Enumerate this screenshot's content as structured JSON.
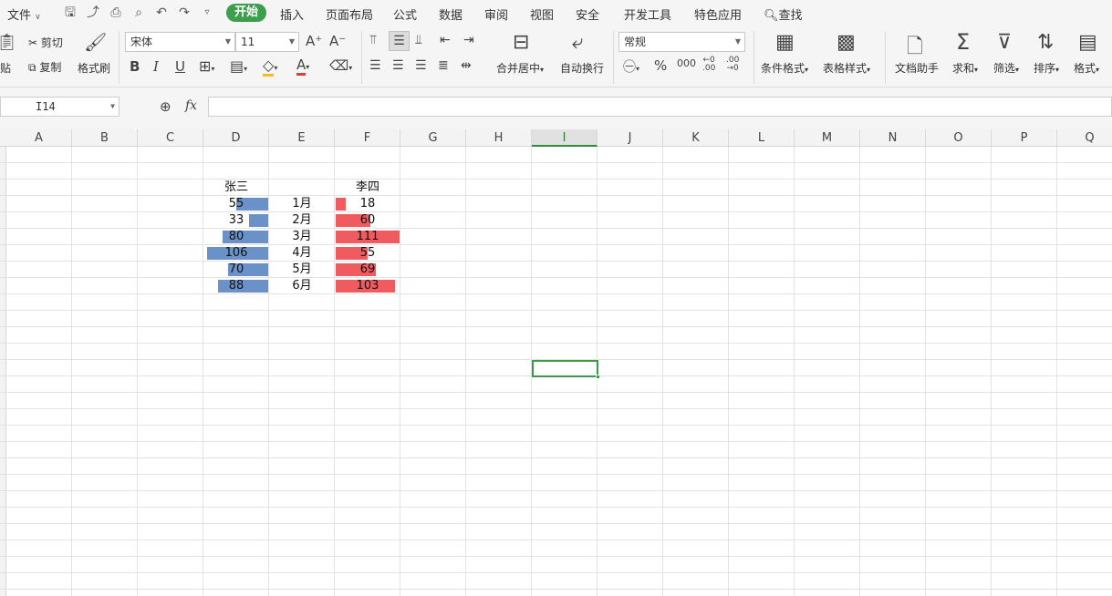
{
  "menu": {
    "file": "文件",
    "tabs": [
      "开始",
      "插入",
      "页面布局",
      "公式",
      "数据",
      "审阅",
      "视图",
      "安全",
      "开发工具",
      "特色应用"
    ],
    "search": "查找"
  },
  "ribbon": {
    "paste": "贴",
    "cut": "剪切",
    "copy": "复制",
    "format_painter": "格式刷",
    "font_name": "宋体",
    "font_size": "11",
    "merge_center": "合并居中",
    "wrap_text": "自动换行",
    "number_format": "常规",
    "conditional_format": "条件格式",
    "table_style": "表格样式",
    "doc_assistant": "文档助手",
    "sum": "求和",
    "filter": "筛选",
    "sort": "排序",
    "format": "格式",
    "colors": {
      "font_color": "#e03a3a",
      "fill_color": "#f0c020"
    }
  },
  "formula_bar": {
    "cell_ref": "I14",
    "fx": "fx",
    "formula": ""
  },
  "columns": [
    "A",
    "B",
    "C",
    "D",
    "E",
    "F",
    "G",
    "H",
    "I",
    "J",
    "K",
    "L",
    "M",
    "N",
    "O",
    "P",
    "Q"
  ],
  "selected_column": "I",
  "selected_cell": "I14",
  "sheet": {
    "header_left": "张三",
    "header_right": "李四",
    "rows": [
      {
        "left": "55",
        "month": "1月",
        "right": "18"
      },
      {
        "left": "33",
        "month": "2月",
        "right": "60"
      },
      {
        "left": "80",
        "month": "3月",
        "right": "111"
      },
      {
        "left": "106",
        "month": "4月",
        "right": "55"
      },
      {
        "left": "70",
        "month": "5月",
        "right": "69"
      },
      {
        "left": "88",
        "month": "6月",
        "right": "103"
      }
    ],
    "bar_max": 111,
    "colors": {
      "left_bar": "#6a92c9",
      "right_bar": "#f05b5f",
      "selection": "#3a9a48"
    }
  },
  "chart_data": {
    "type": "bar",
    "categories": [
      "1月",
      "2月",
      "3月",
      "4月",
      "5月",
      "6月"
    ],
    "series": [
      {
        "name": "张三",
        "values": [
          55,
          33,
          80,
          106,
          70,
          88
        ]
      },
      {
        "name": "李四",
        "values": [
          18,
          60,
          111,
          55,
          69,
          103
        ]
      }
    ]
  }
}
